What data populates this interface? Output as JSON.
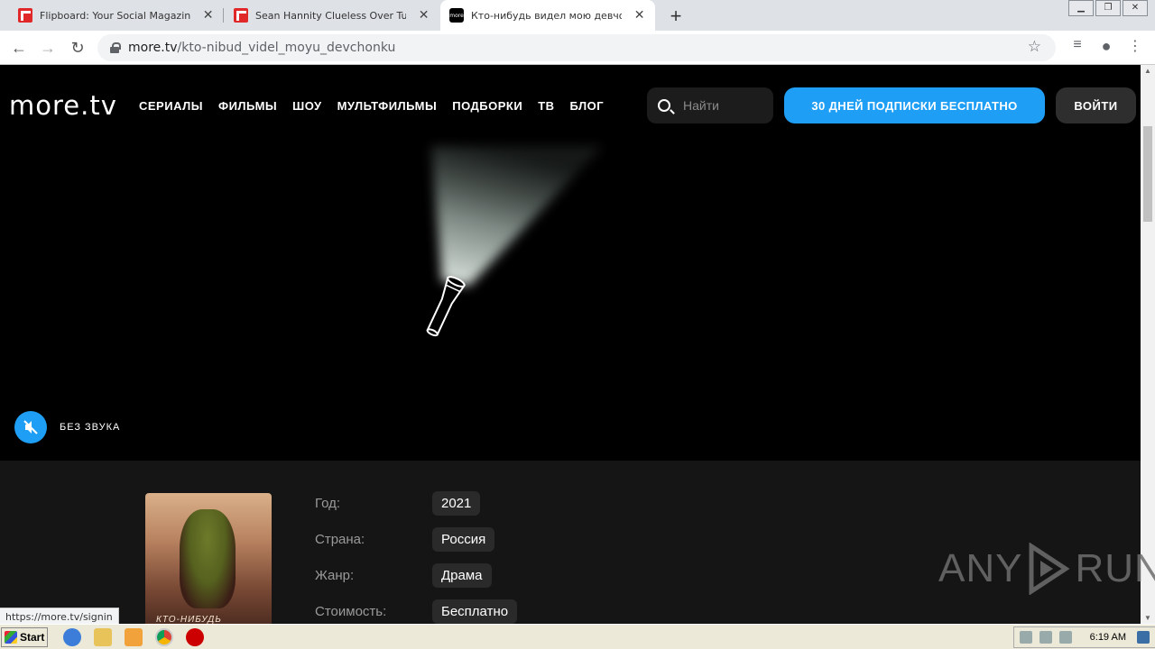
{
  "browser": {
    "tabs": [
      {
        "title": "Flipboard: Your Social Magazine",
        "favicon": "flipboard-icon",
        "active": false
      },
      {
        "title": "Sean Hannity Clueless Over Tucker C",
        "favicon": "flipboard-icon",
        "active": false
      },
      {
        "title": "Кто-нибудь видел мою девчонку?",
        "favicon": "more-tv-icon",
        "active": true
      }
    ],
    "new_tab": "+",
    "address": {
      "host": "more.tv",
      "path": "/kto-nibud_videl_moyu_devchonku"
    },
    "status_url": "https://more.tv/signin"
  },
  "site": {
    "logo": "more.tv",
    "menu": [
      "СЕРИАЛЫ",
      "ФИЛЬМЫ",
      "ШОУ",
      "МУЛЬТФИЛЬМЫ",
      "ПОДБОРКИ",
      "ТВ",
      "БЛОГ"
    ],
    "search_placeholder": "Найти",
    "promo_button": "30 ДНЕЙ ПОДПИСКИ БЕСПЛАТНО",
    "login_button": "ВОЙТИ",
    "mute_label": "БЕЗ ЗВУКА",
    "accent": "#1f9ef5",
    "poster_title": "КТО-НИБУДЬ",
    "facts": [
      {
        "label": "Год:",
        "value": "2021"
      },
      {
        "label": "Страна:",
        "value": "Россия"
      },
      {
        "label": "Жанр:",
        "value": "Драма"
      },
      {
        "label": "Стоимость:",
        "value": "Бесплатно"
      }
    ]
  },
  "watermark": {
    "left": "ANY",
    "right": "RUN"
  },
  "taskbar": {
    "start": "Start",
    "clock": "6:19 AM"
  }
}
